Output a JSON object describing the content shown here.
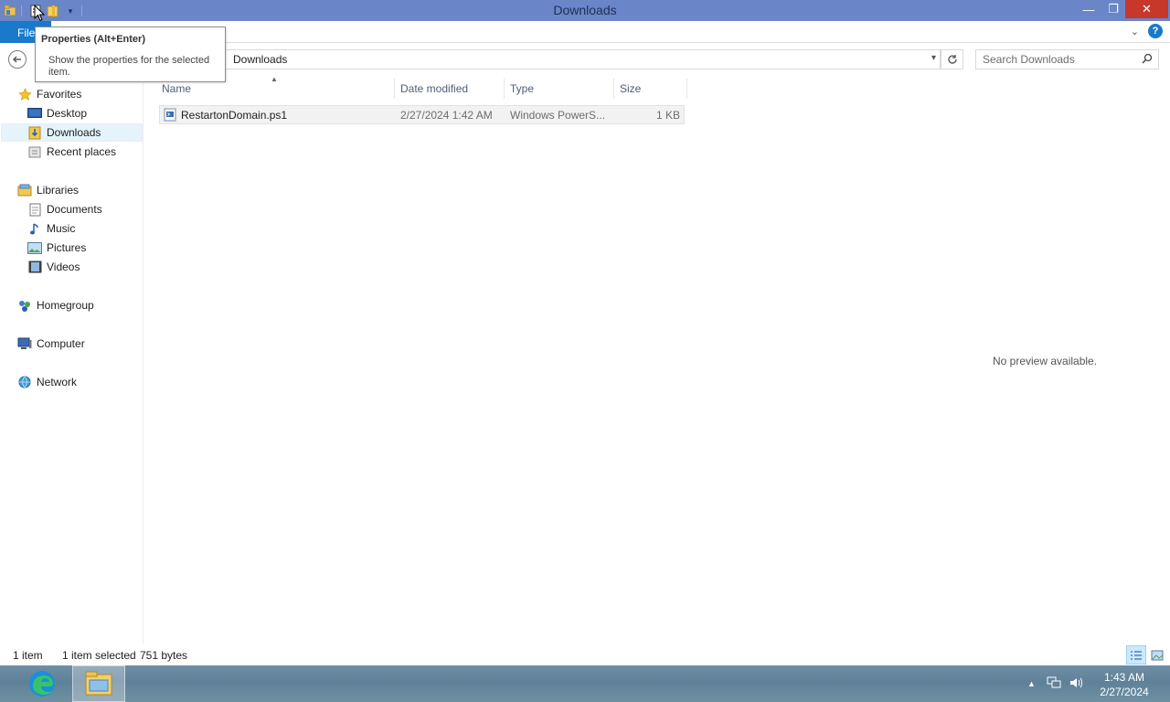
{
  "window": {
    "title": "Downloads",
    "controls": {
      "minimize": "—",
      "maximize": "❐",
      "close": "✕"
    }
  },
  "ribbon": {
    "file_tab": "File",
    "help": "?"
  },
  "tooltip": {
    "title": "Properties (Alt+Enter)",
    "body": "Show the properties for the selected item."
  },
  "address": {
    "path": "Downloads"
  },
  "search": {
    "placeholder": "Search Downloads"
  },
  "navigation": {
    "favorites": "Favorites",
    "desktop": "Desktop",
    "downloads": "Downloads",
    "recent_places": "Recent places",
    "libraries": "Libraries",
    "documents": "Documents",
    "music": "Music",
    "pictures": "Pictures",
    "videos": "Videos",
    "homegroup": "Homegroup",
    "computer": "Computer",
    "network": "Network"
  },
  "columns": {
    "name": "Name",
    "date_modified": "Date modified",
    "type": "Type",
    "size": "Size"
  },
  "files": [
    {
      "name": "RestartonDomain.ps1",
      "date_modified": "2/27/2024 1:42 AM",
      "type": "Windows PowerS...",
      "size": "1 KB"
    }
  ],
  "preview": {
    "message": "No preview available."
  },
  "status": {
    "item_count": "1 item",
    "selection": "1 item selected",
    "size": "751 bytes"
  },
  "taskbar": {
    "time": "1:43 AM",
    "date": "2/27/2024"
  },
  "colors": {
    "titlebar": "#6a86c9",
    "file_tab": "#1979ca",
    "close_button": "#c7372a",
    "selection": "#e5f3fb"
  }
}
